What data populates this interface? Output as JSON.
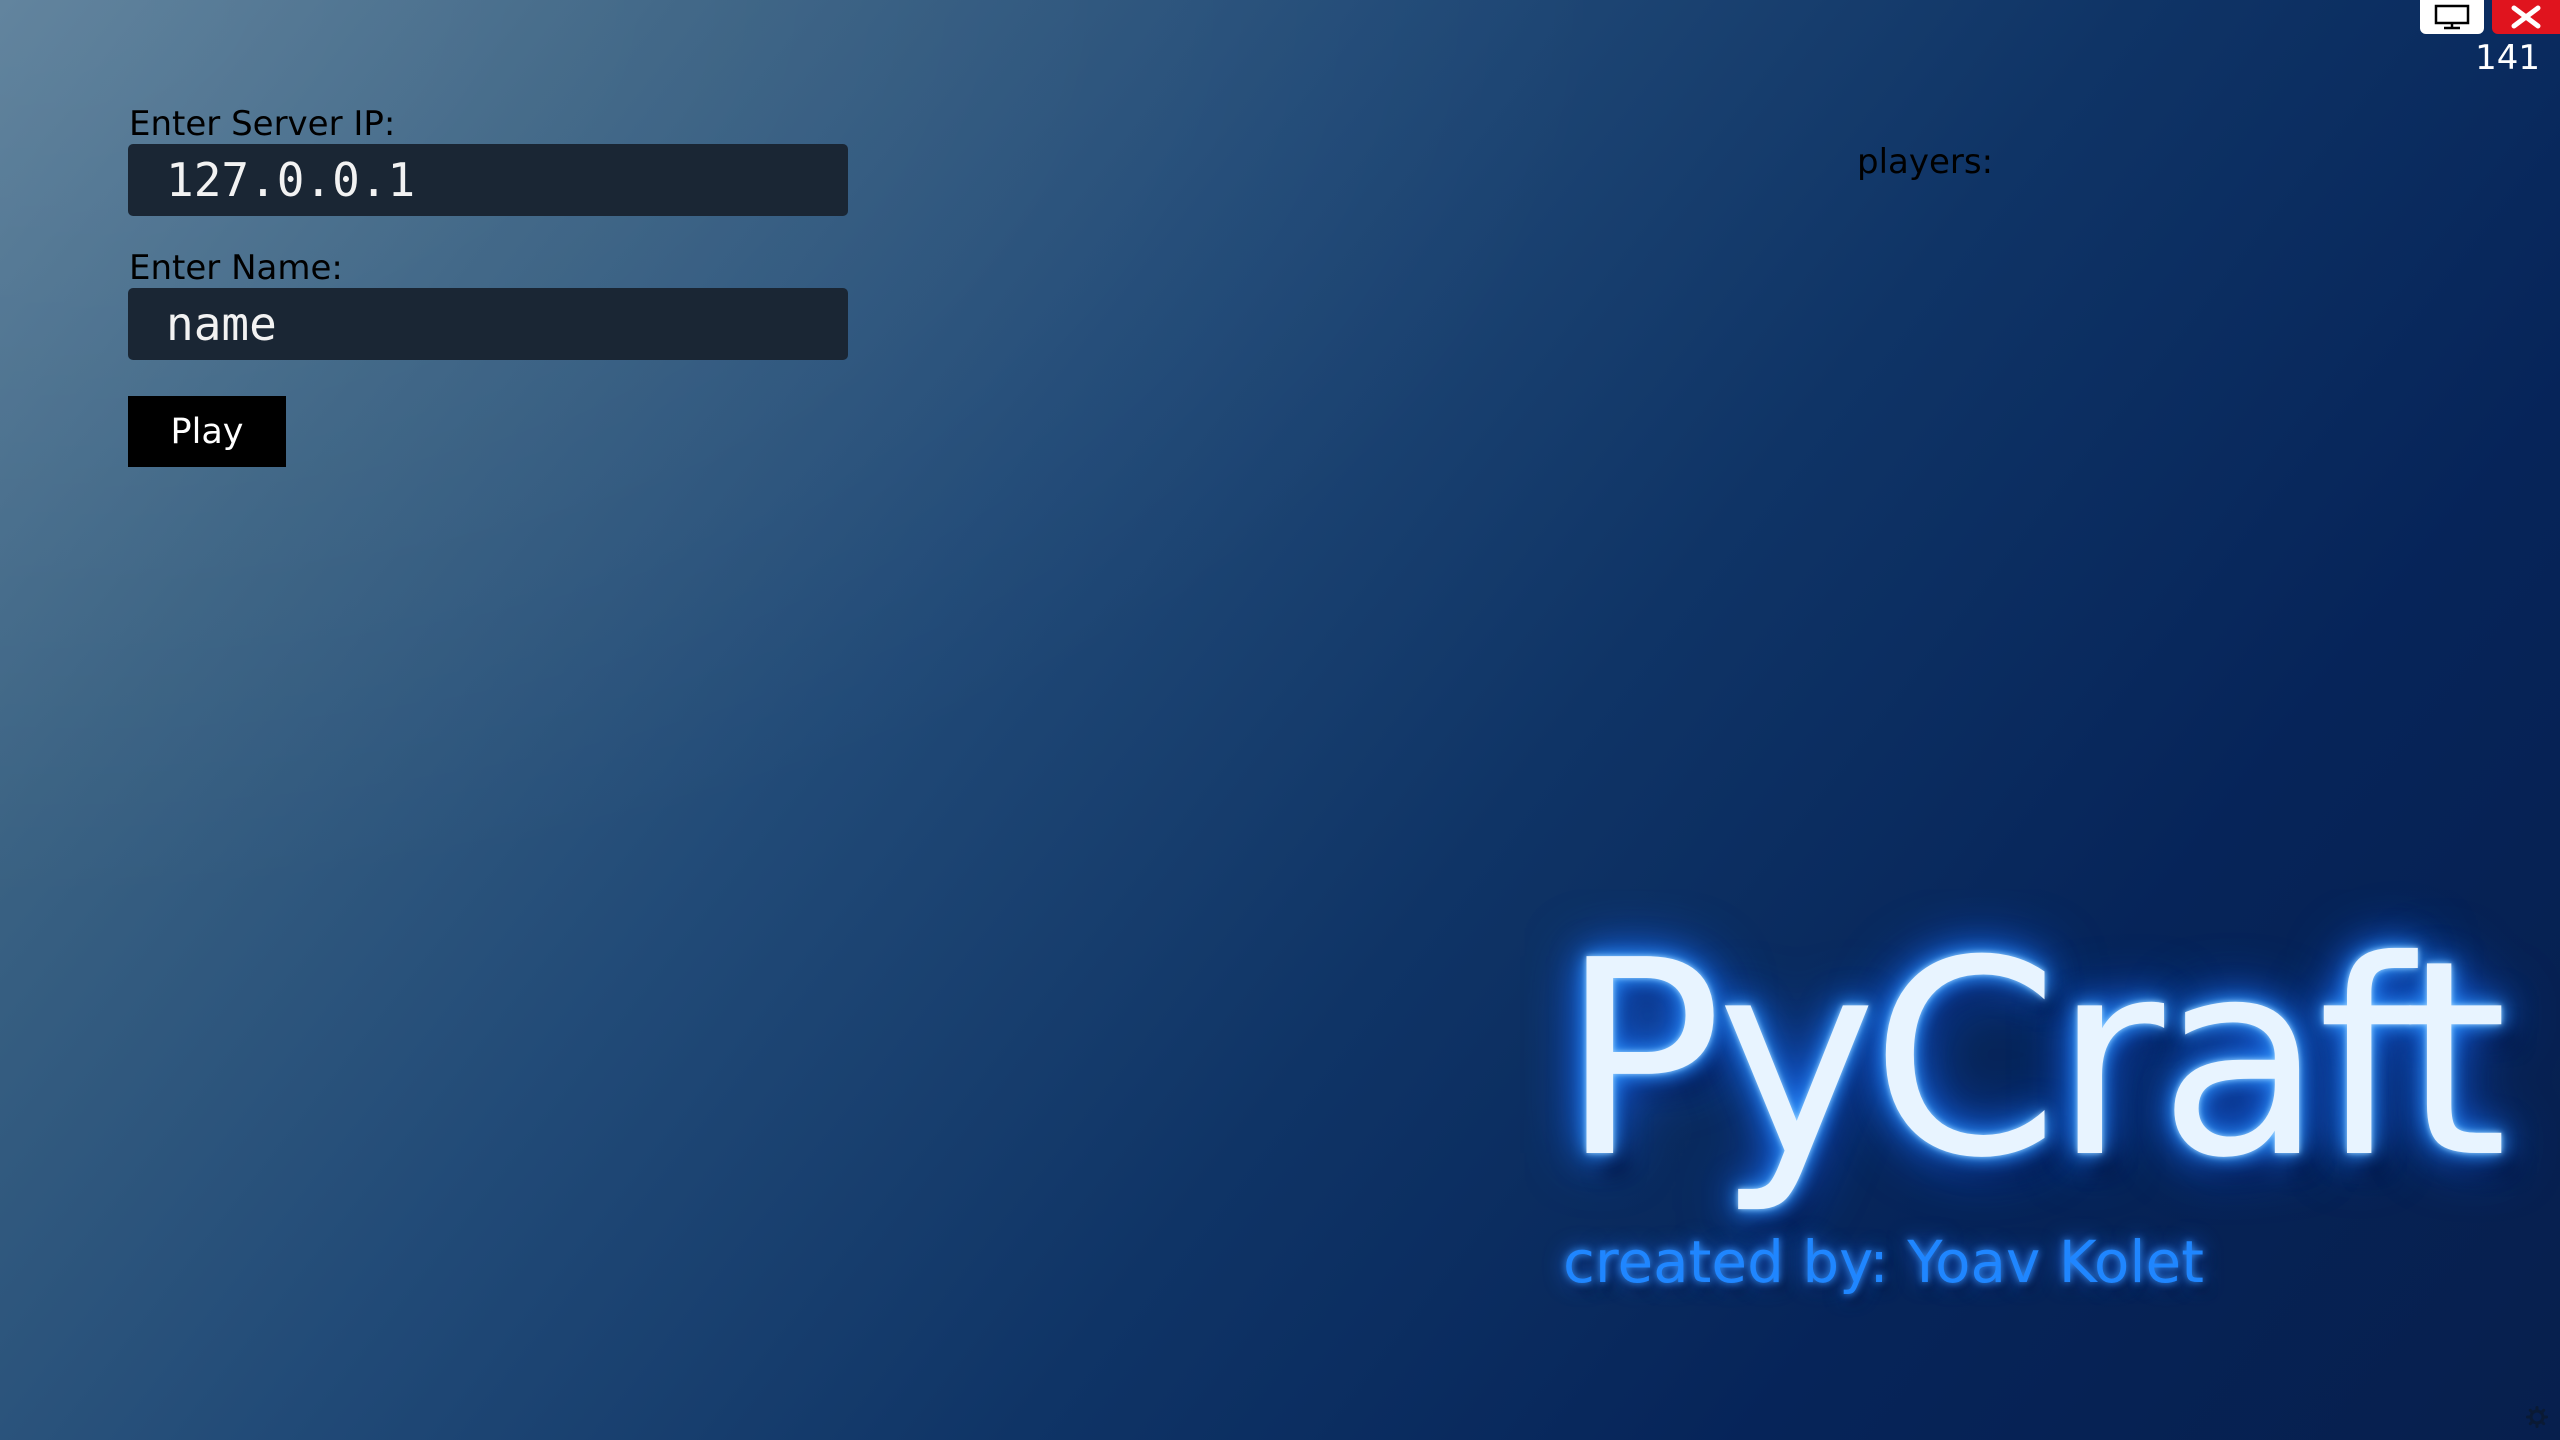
{
  "form": {
    "server_ip_label": "Enter Server IP:",
    "server_ip_value": "127.0.0.1",
    "name_label": "Enter Name:",
    "name_value": "name",
    "play_label": "Play"
  },
  "players": {
    "label": "players:"
  },
  "topbar": {
    "counter": "141",
    "icons": {
      "window": "monitor-icon",
      "close": "close-icon"
    }
  },
  "branding": {
    "title": "PyCraft",
    "credit": "created by: Yoav Kolet"
  },
  "colors": {
    "close_button": "#e0141e",
    "glow_blue": "#1f86ff",
    "input_bg": "#1a2634"
  }
}
